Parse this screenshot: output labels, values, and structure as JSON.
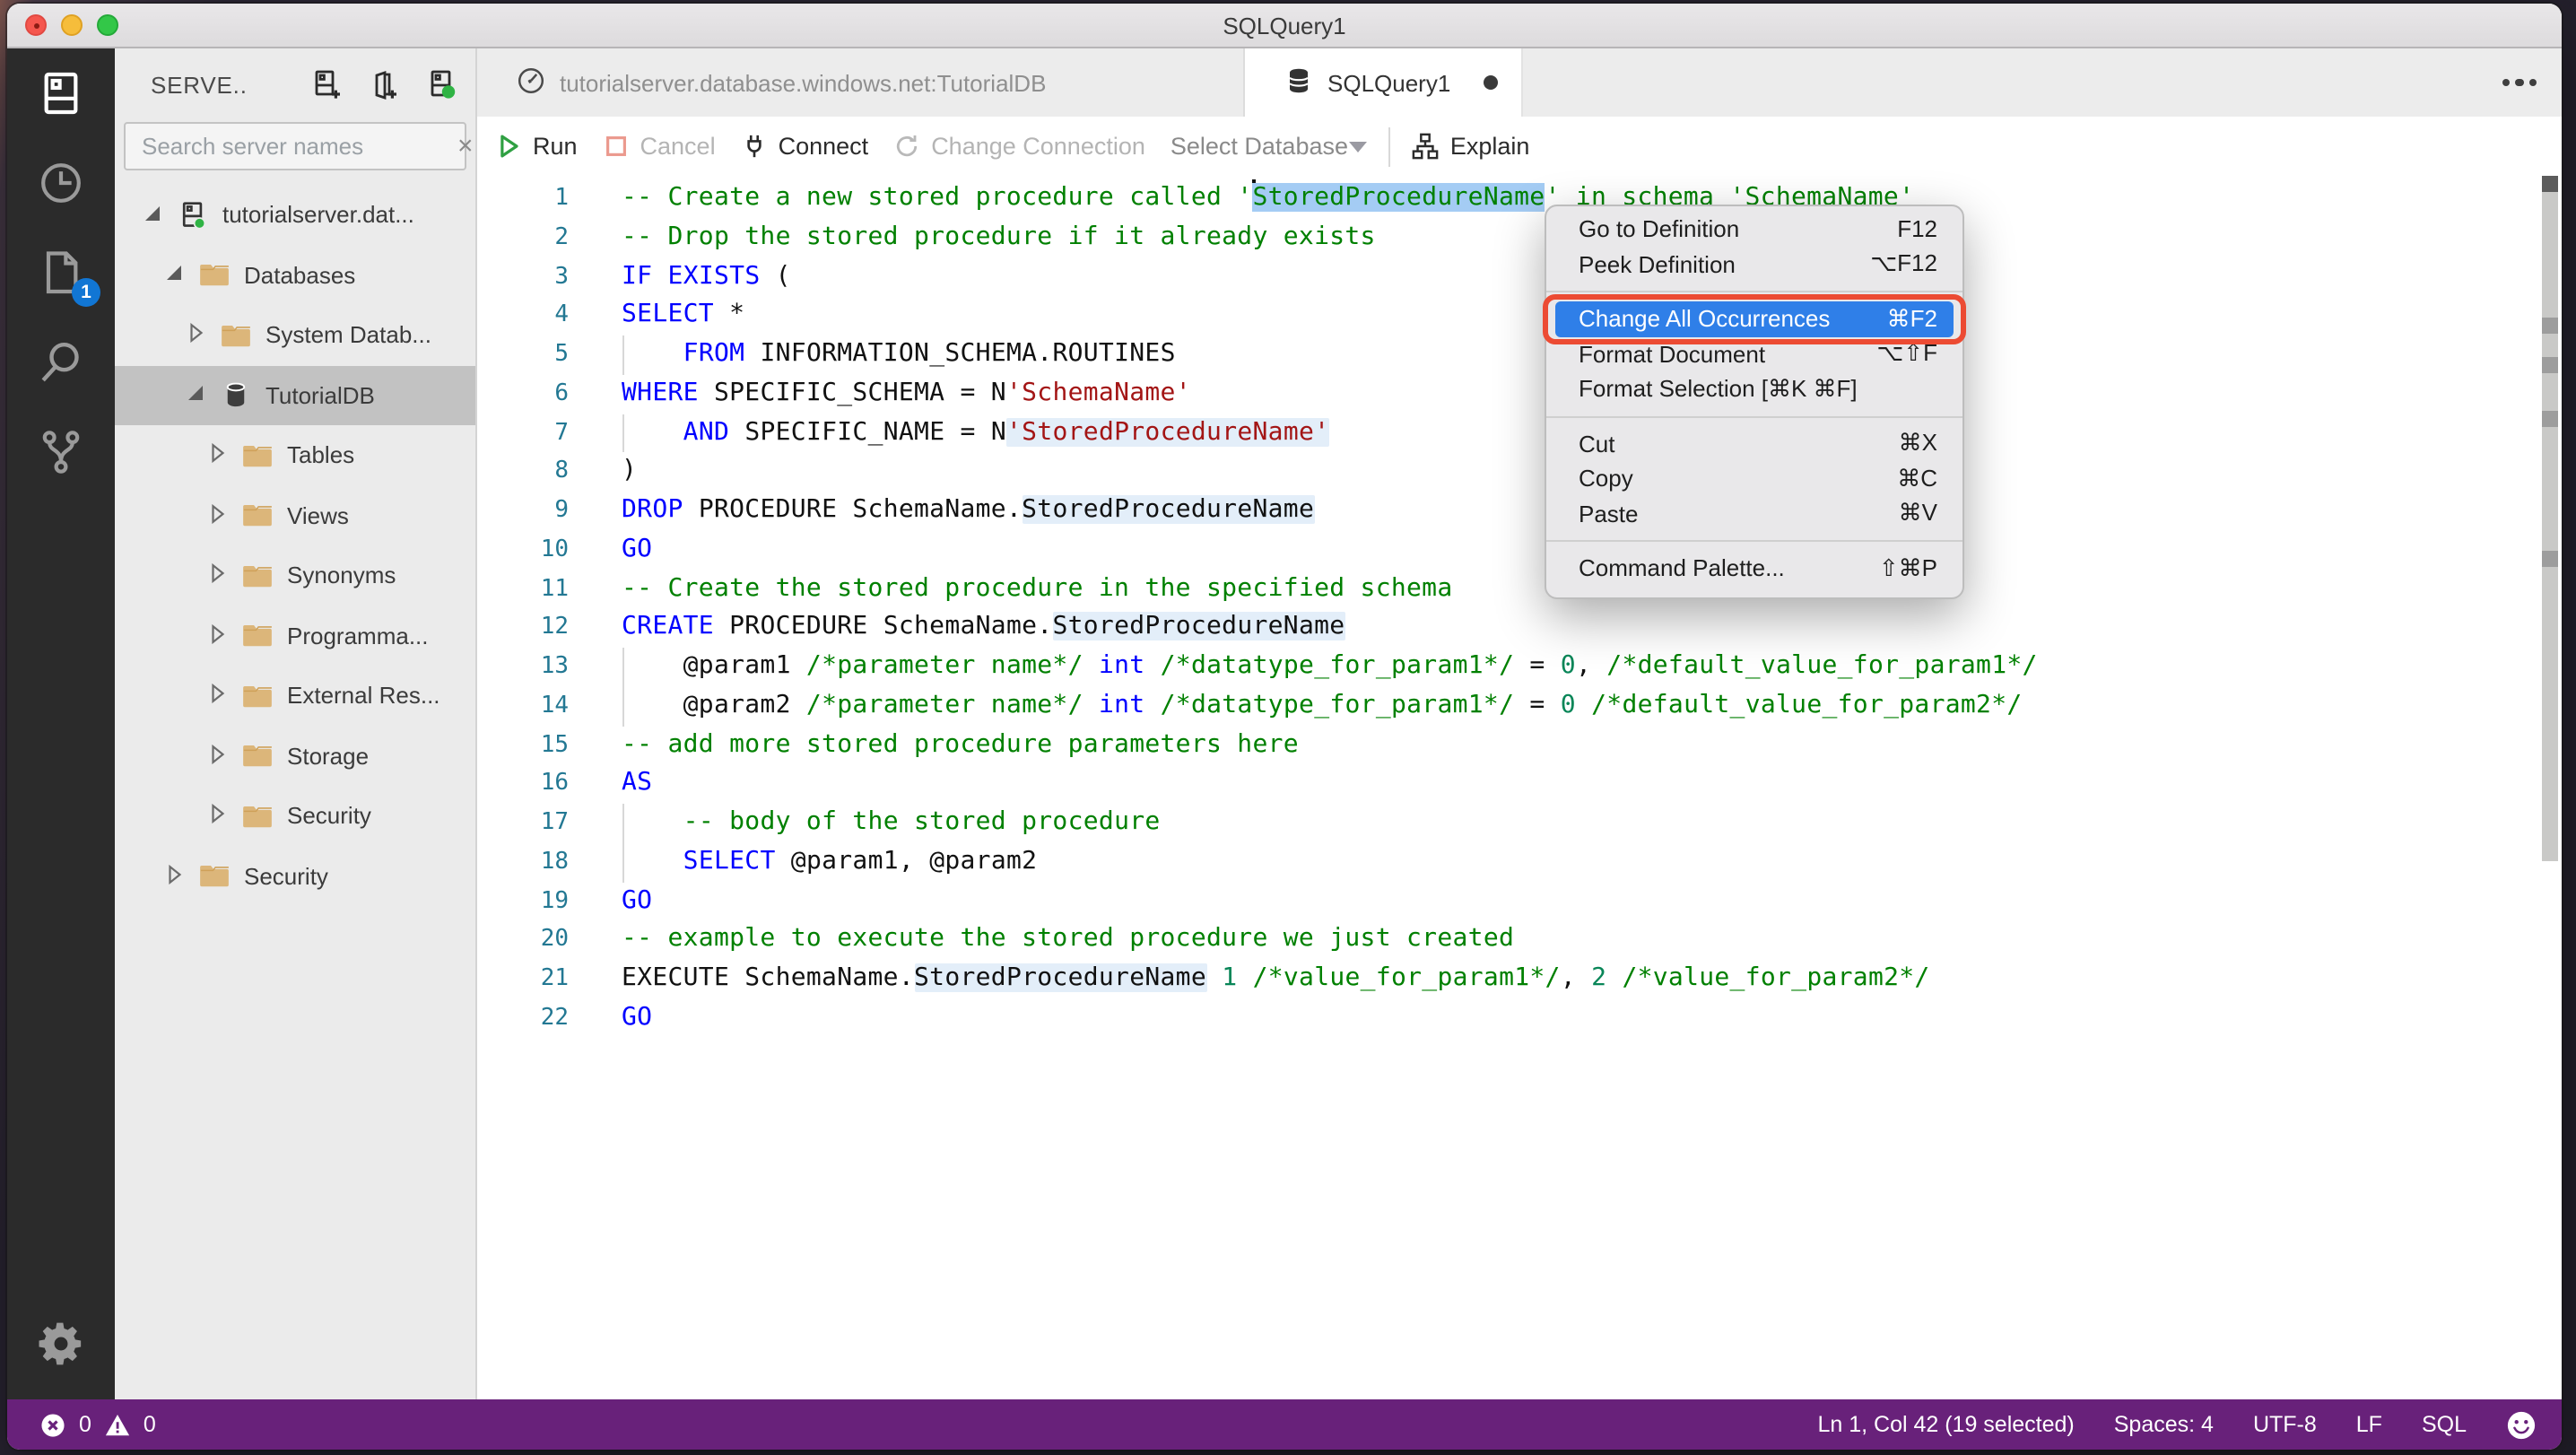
{
  "window": {
    "title": "SQLQuery1"
  },
  "activity_bar": {
    "items": [
      {
        "name": "servers-icon",
        "active": true
      },
      {
        "name": "task-history-icon",
        "active": false
      },
      {
        "name": "open-editors-icon",
        "active": false,
        "badge": "1"
      },
      {
        "name": "search-icon",
        "active": false
      },
      {
        "name": "source-control-icon",
        "active": false
      }
    ],
    "bottom": {
      "name": "settings-gear-icon"
    }
  },
  "sidebar": {
    "header": "SERVE..",
    "header_icons": [
      "new-connection-icon",
      "new-server-group-icon",
      "active-connections-icon"
    ],
    "search_placeholder": "Search server names",
    "clear_label": "×",
    "tree": [
      {
        "label": "tutorialserver.dat...",
        "level": 0,
        "icon": "server",
        "arrow": "expanded",
        "selected": false
      },
      {
        "label": "Databases",
        "level": 1,
        "icon": "folder",
        "arrow": "expanded",
        "selected": false
      },
      {
        "label": "System Datab...",
        "level": 2,
        "icon": "folder",
        "arrow": "collapsed",
        "selected": false
      },
      {
        "label": "TutorialDB",
        "level": 2,
        "icon": "database",
        "arrow": "expanded",
        "selected": true
      },
      {
        "label": "Tables",
        "level": 3,
        "icon": "folder",
        "arrow": "collapsed",
        "selected": false
      },
      {
        "label": "Views",
        "level": 3,
        "icon": "folder",
        "arrow": "collapsed",
        "selected": false
      },
      {
        "label": "Synonyms",
        "level": 3,
        "icon": "folder",
        "arrow": "collapsed",
        "selected": false
      },
      {
        "label": "Programma...",
        "level": 3,
        "icon": "folder",
        "arrow": "collapsed",
        "selected": false
      },
      {
        "label": "External Res...",
        "level": 3,
        "icon": "folder",
        "arrow": "collapsed",
        "selected": false
      },
      {
        "label": "Storage",
        "level": 3,
        "icon": "folder",
        "arrow": "collapsed",
        "selected": false
      },
      {
        "label": "Security",
        "level": 3,
        "icon": "folder",
        "arrow": "collapsed",
        "selected": false
      },
      {
        "label": "Security",
        "level": 1,
        "icon": "folder",
        "arrow": "collapsed",
        "selected": false
      }
    ]
  },
  "tabs": [
    {
      "label": "tutorialserver.database.windows.net:TutorialDB",
      "icon": "dashboard-icon",
      "active": false,
      "dirty": false
    },
    {
      "label": "SQLQuery1",
      "icon": "database-icon",
      "active": true,
      "dirty": true
    }
  ],
  "toolbar": {
    "run": "Run",
    "cancel": "Cancel",
    "connect": "Connect",
    "change_connection": "Change Connection",
    "select_database": "Select Database",
    "explain": "Explain"
  },
  "editor": {
    "lines": [
      {
        "n": 1,
        "guide": false,
        "segs": [
          {
            "t": "-- Create a new stored procedure called '",
            "c": "c"
          },
          {
            "t": "StoredProcedureName",
            "c": "c",
            "sel": true,
            "cursorBefore": true
          },
          {
            "t": "' in schema 'SchemaName'",
            "c": "c"
          }
        ]
      },
      {
        "n": 2,
        "guide": false,
        "segs": [
          {
            "t": "-- Drop the stored procedure if it already exists",
            "c": "c"
          }
        ]
      },
      {
        "n": 3,
        "guide": false,
        "segs": [
          {
            "t": "IF",
            "c": "k"
          },
          {
            "t": " ",
            "c": "p"
          },
          {
            "t": "EXISTS",
            "c": "k"
          },
          {
            "t": " (",
            "c": "p"
          }
        ]
      },
      {
        "n": 4,
        "guide": false,
        "segs": [
          {
            "t": "SELECT",
            "c": "k"
          },
          {
            "t": " *",
            "c": "p"
          }
        ]
      },
      {
        "n": 5,
        "guide": true,
        "segs": [
          {
            "t": "    ",
            "c": "p"
          },
          {
            "t": "FROM",
            "c": "k"
          },
          {
            "t": " INFORMATION_SCHEMA.ROUTINES",
            "c": "p"
          }
        ]
      },
      {
        "n": 6,
        "guide": false,
        "segs": [
          {
            "t": "WHERE",
            "c": "k"
          },
          {
            "t": " SPECIFIC_SCHEMA = N",
            "c": "p"
          },
          {
            "t": "'SchemaName'",
            "c": "s"
          }
        ]
      },
      {
        "n": 7,
        "guide": true,
        "segs": [
          {
            "t": "    ",
            "c": "p"
          },
          {
            "t": "AND",
            "c": "k"
          },
          {
            "t": " SPECIFIC_NAME = N",
            "c": "p"
          },
          {
            "t": "'StoredProcedureName'",
            "c": "s",
            "hl": true
          }
        ]
      },
      {
        "n": 8,
        "guide": false,
        "segs": [
          {
            "t": ")",
            "c": "p"
          }
        ]
      },
      {
        "n": 9,
        "guide": false,
        "segs": [
          {
            "t": "DROP",
            "c": "k"
          },
          {
            "t": " PROCEDURE SchemaName.",
            "c": "p"
          },
          {
            "t": "StoredProcedureName",
            "c": "p",
            "hl": true
          }
        ]
      },
      {
        "n": 10,
        "guide": false,
        "segs": [
          {
            "t": "GO",
            "c": "k"
          }
        ]
      },
      {
        "n": 11,
        "guide": false,
        "segs": [
          {
            "t": "-- Create the stored procedure in the specified schema",
            "c": "c"
          }
        ]
      },
      {
        "n": 12,
        "guide": false,
        "segs": [
          {
            "t": "CREATE",
            "c": "k"
          },
          {
            "t": " PROCEDURE SchemaName.",
            "c": "p"
          },
          {
            "t": "StoredProcedureName",
            "c": "p",
            "hl": true
          }
        ]
      },
      {
        "n": 13,
        "guide": true,
        "segs": [
          {
            "t": "    @param1 ",
            "c": "p"
          },
          {
            "t": "/*parameter name*/",
            "c": "c"
          },
          {
            "t": " ",
            "c": "p"
          },
          {
            "t": "int",
            "c": "k"
          },
          {
            "t": " ",
            "c": "p"
          },
          {
            "t": "/*datatype_for_param1*/",
            "c": "c"
          },
          {
            "t": " = ",
            "c": "p"
          },
          {
            "t": "0",
            "c": "n"
          },
          {
            "t": ", ",
            "c": "p"
          },
          {
            "t": "/*default_value_for_param1*/",
            "c": "c"
          }
        ]
      },
      {
        "n": 14,
        "guide": true,
        "segs": [
          {
            "t": "    @param2 ",
            "c": "p"
          },
          {
            "t": "/*parameter name*/",
            "c": "c"
          },
          {
            "t": " ",
            "c": "p"
          },
          {
            "t": "int",
            "c": "k"
          },
          {
            "t": " ",
            "c": "p"
          },
          {
            "t": "/*datatype_for_param1*/",
            "c": "c"
          },
          {
            "t": " = ",
            "c": "p"
          },
          {
            "t": "0",
            "c": "n"
          },
          {
            "t": " ",
            "c": "p"
          },
          {
            "t": "/*default_value_for_param2*/",
            "c": "c"
          }
        ]
      },
      {
        "n": 15,
        "guide": false,
        "segs": [
          {
            "t": "-- add more stored procedure parameters here",
            "c": "c"
          }
        ]
      },
      {
        "n": 16,
        "guide": false,
        "segs": [
          {
            "t": "AS",
            "c": "k"
          }
        ]
      },
      {
        "n": 17,
        "guide": true,
        "segs": [
          {
            "t": "    ",
            "c": "p"
          },
          {
            "t": "-- body of the stored procedure",
            "c": "c"
          }
        ]
      },
      {
        "n": 18,
        "guide": true,
        "segs": [
          {
            "t": "    ",
            "c": "p"
          },
          {
            "t": "SELECT",
            "c": "k"
          },
          {
            "t": " @param1, @param2",
            "c": "p"
          }
        ]
      },
      {
        "n": 19,
        "guide": false,
        "segs": [
          {
            "t": "GO",
            "c": "k"
          }
        ]
      },
      {
        "n": 20,
        "guide": false,
        "segs": [
          {
            "t": "-- example to execute the stored procedure we just created",
            "c": "c"
          }
        ]
      },
      {
        "n": 21,
        "guide": false,
        "segs": [
          {
            "t": "EXECUTE SchemaName.",
            "c": "p"
          },
          {
            "t": "StoredProcedureName",
            "c": "p",
            "hl": true
          },
          {
            "t": " ",
            "c": "p"
          },
          {
            "t": "1",
            "c": "n"
          },
          {
            "t": " ",
            "c": "p"
          },
          {
            "t": "/*value_for_param1*/",
            "c": "c"
          },
          {
            "t": ", ",
            "c": "p"
          },
          {
            "t": "2",
            "c": "n"
          },
          {
            "t": " ",
            "c": "p"
          },
          {
            "t": "/*value_for_param2*/",
            "c": "c"
          }
        ]
      },
      {
        "n": 22,
        "guide": false,
        "segs": [
          {
            "t": "GO",
            "c": "k"
          }
        ]
      }
    ],
    "ruler_markers_y": [
      72,
      94,
      124,
      202
    ]
  },
  "context_menu": {
    "items": [
      {
        "label": "Go to Definition",
        "shortcut": "F12"
      },
      {
        "label": "Peek Definition",
        "shortcut": "⌥F12"
      },
      {
        "sep": true
      },
      {
        "label": "Change All Occurrences",
        "shortcut": "⌘F2",
        "highlighted": true,
        "focus_ring": true
      },
      {
        "label": "Format Document",
        "shortcut": "⌥⇧F"
      },
      {
        "label": "Format Selection [⌘K ⌘F]",
        "shortcut": ""
      },
      {
        "sep": true
      },
      {
        "label": "Cut",
        "shortcut": "⌘X"
      },
      {
        "label": "Copy",
        "shortcut": "⌘C"
      },
      {
        "label": "Paste",
        "shortcut": "⌘V"
      },
      {
        "sep": true
      },
      {
        "label": "Command Palette...",
        "shortcut": "⇧⌘P"
      }
    ],
    "highlight_color": "#2f7fe8",
    "focus_ring_color": "#ec4b33"
  },
  "status_bar": {
    "background": "#68217a",
    "errors": "0",
    "warnings": "0",
    "right_items": [
      "Ln 1, Col 42 (19 selected)",
      "Spaces: 4",
      "UTF-8",
      "LF",
      "SQL"
    ]
  },
  "colors": {
    "keyword": "#0000ff",
    "comment": "#008000",
    "string": "#a31515",
    "number": "#098658",
    "selection": "#a4ccf4",
    "occurrence_highlight": "#e3eef9",
    "folder": "#dcb67a",
    "badge": "#1176d4",
    "connected_dot": "#2fb344"
  }
}
